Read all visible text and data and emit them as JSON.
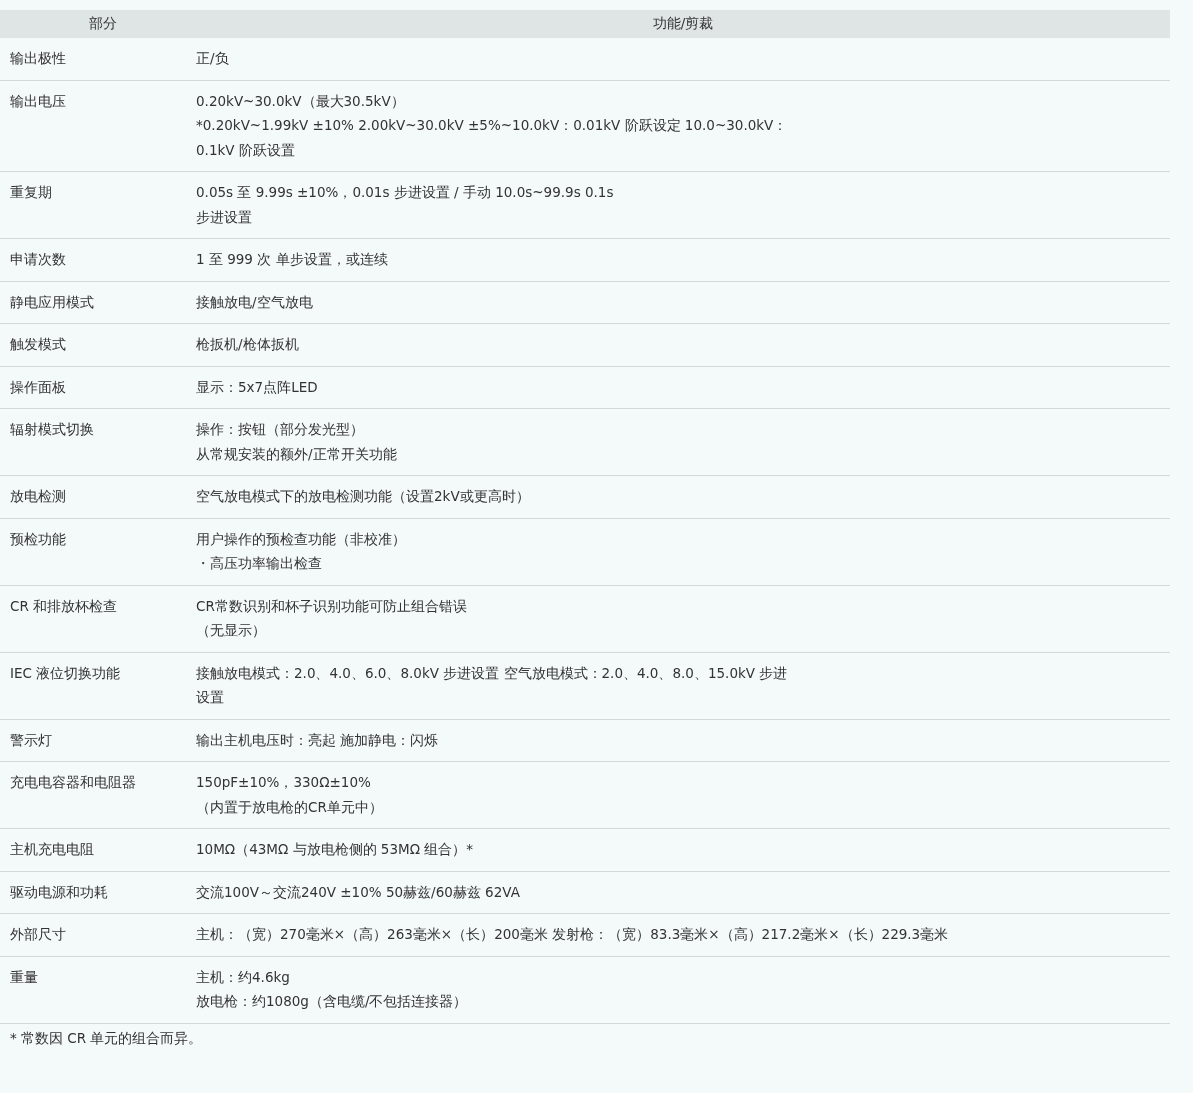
{
  "table": {
    "columns": [
      "部分",
      "功能/剪裁"
    ],
    "rows": [
      {
        "part": "输出极性",
        "lines": [
          "正/负"
        ]
      },
      {
        "part": "输出电压",
        "lines": [
          "0.20kV~30.0kV（最大30.5kV）",
          "*0.20kV~1.99kV ±10% 2.00kV~30.0kV ±5%~10.0kV：0.01kV 阶跃设定 10.0~30.0kV：",
          "0.1kV 阶跃设置"
        ]
      },
      {
        "part": "重复期",
        "lines": [
          "0.05s 至 9.99s ±10%，0.01s 步进设置 / 手动 10.0s~99.9s 0.1s",
          "步进设置"
        ]
      },
      {
        "part": "申请次数",
        "lines": [
          "1 至 999 次 单步设置，或连续"
        ]
      },
      {
        "part": "静电应用模式",
        "lines": [
          "接触放电/空气放电"
        ]
      },
      {
        "part": "触发模式",
        "lines": [
          "枪扳机/枪体扳机"
        ]
      },
      {
        "part": "操作面板",
        "lines": [
          "显示：5x7点阵LED"
        ]
      },
      {
        "part": "辐射模式切换",
        "lines": [
          "操作：按钮（部分发光型）",
          "从常规安装的额外/正常开关功能"
        ]
      },
      {
        "part": "放电检测",
        "lines": [
          "空气放电模式下的放电检测功能（设置2kV或更高时）"
        ]
      },
      {
        "part": "预检功能",
        "lines": [
          "用户操作的预检查功能（非校准）",
          "・高压功率输出检查"
        ]
      },
      {
        "part": "CR 和排放杯检查",
        "lines": [
          "CR常数识别和杯子识别功能可防止组合错误",
          "（无显示）"
        ]
      },
      {
        "part": "IEC 液位切换功能",
        "lines": [
          "接触放电模式：2.0、4.0、6.0、8.0kV 步进设置 空气放电模式：2.0、4.0、8.0、15.0kV 步进",
          "设置"
        ]
      },
      {
        "part": "警示灯",
        "lines": [
          "输出主机电压时：亮起 施加静电：闪烁"
        ]
      },
      {
        "part": "充电电容器和电阻器",
        "lines": [
          "150pF±10%，330Ω±10%",
          "（内置于放电枪的CR单元中）"
        ]
      },
      {
        "part": "主机充电电阻",
        "lines": [
          "10MΩ（43MΩ 与放电枪侧的 53MΩ 组合）*"
        ]
      },
      {
        "part": "驱动电源和功耗",
        "lines": [
          "交流100V～交流240V ±10% 50赫兹/60赫兹 62VA"
        ]
      },
      {
        "part": "外部尺寸",
        "lines": [
          "主机：（宽）270毫米×（高）263毫米×（长）200毫米 发射枪：（宽）83.3毫米×（高）217.2毫米×（长）229.3毫米"
        ]
      },
      {
        "part": "重量",
        "lines": [
          "主机：约4.6kg",
          "放电枪：约1080g（含电缆/不包括连接器）"
        ]
      }
    ]
  },
  "footnote": "* 常数因 CR 单元的组合而异。"
}
